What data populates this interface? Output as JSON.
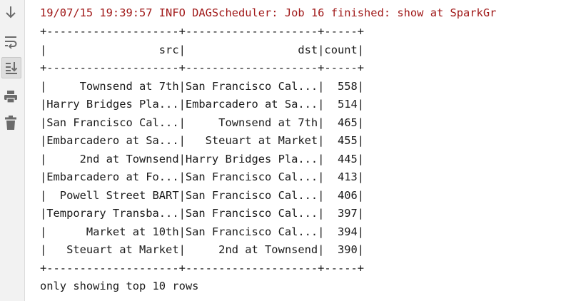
{
  "toolbar": {
    "buttons": [
      {
        "icon": "arrow-down-icon"
      },
      {
        "icon": "soft-wrap-icon"
      },
      {
        "icon": "scroll-to-end-icon",
        "active": true
      },
      {
        "icon": "print-icon"
      },
      {
        "icon": "trash-icon"
      }
    ]
  },
  "console": {
    "log_line": "19/07/15 19:39:57 INFO DAGScheduler: Job 16 finished: show at SparkGr",
    "border": "+--------------------+--------------------+-----+",
    "header": "|                 src|                 dst|count|",
    "rows": [
      "|     Townsend at 7th|San Francisco Cal...|  558|",
      "|Harry Bridges Pla...|Embarcadero at Sa...|  514|",
      "|San Francisco Cal...|     Townsend at 7th|  465|",
      "|Embarcadero at Sa...|   Steuart at Market|  455|",
      "|     2nd at Townsend|Harry Bridges Pla...|  445|",
      "|Embarcadero at Fo...|San Francisco Cal...|  413|",
      "|  Powell Street BART|San Francisco Cal...|  406|",
      "|Temporary Transba...|San Francisco Cal...|  397|",
      "|      Market at 10th|San Francisco Cal...|  394|",
      "|   Steuart at Market|     2nd at Townsend|  390|"
    ],
    "footer": "only showing top 10 rows"
  }
}
